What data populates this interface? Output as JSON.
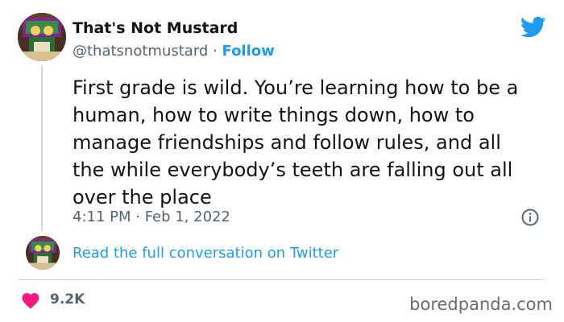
{
  "author": {
    "display_name": "That's Not Mustard",
    "handle": "@thatsnotmustard",
    "separator": " · ",
    "follow_label": "Follow"
  },
  "tweet": {
    "text": "First grade is wild. You’re learning how to be a\nhuman, how to write things down, how to\nmanage friendships and follow rules, and all\nthe while everybody’s teeth are falling out all\nover the place",
    "timestamp": "4:11 PM · Feb 1, 2022"
  },
  "conversation": {
    "link_label": "Read the full conversation on Twitter"
  },
  "engagement": {
    "like_count": "9.2K"
  },
  "watermark": "boredpanda.com",
  "icons": {
    "brand": "twitter-bird-icon",
    "info": "info-icon",
    "like": "heart-icon"
  },
  "colors": {
    "accent": "#1d9bf0",
    "heart": "#f91880",
    "muted": "#536471",
    "text": "#0f1419",
    "divider": "#cfd9de"
  }
}
